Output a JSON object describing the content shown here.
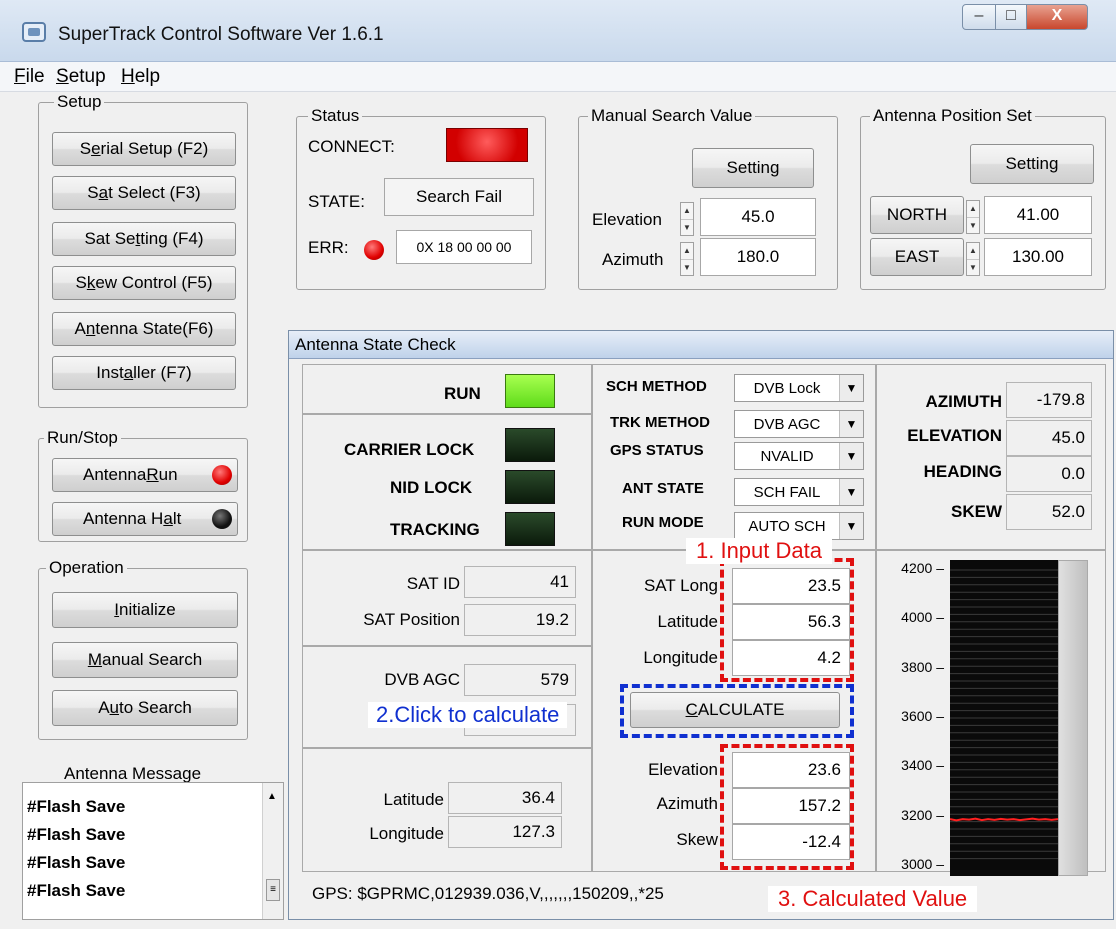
{
  "window": {
    "title": "SuperTrack Control Software Ver 1.6.1",
    "min_glyph": "–",
    "max_glyph": "□",
    "close_glyph": "X"
  },
  "menu": [
    {
      "accel": "F",
      "rest": "ile"
    },
    {
      "accel": "S",
      "rest": "etup"
    },
    {
      "accel": "H",
      "rest": "elp"
    }
  ],
  "setup": {
    "legend": "Setup",
    "serial": {
      "pre": "S",
      "accel": "e",
      "post": "rial Setup (F2)"
    },
    "sat_select": {
      "pre": "S",
      "accel": "a",
      "post": "t Select  (F3)"
    },
    "sat_setting": {
      "pre": "Sat Se",
      "accel": "t",
      "post": "ting  (F4)"
    },
    "skew": {
      "pre": "S",
      "accel": "k",
      "post": "ew Control (F5)"
    },
    "antenna_state": {
      "pre": "A",
      "accel": "n",
      "post": "tenna State(F6)"
    },
    "installer": {
      "pre": "Inst",
      "accel": "a",
      "post": "ller    (F7)"
    }
  },
  "runstop": {
    "legend": "Run/Stop",
    "run": {
      "pre": "Antenna ",
      "accel": "R",
      "post": "un"
    },
    "halt": {
      "pre": "Antenna H",
      "accel": "a",
      "post": "lt"
    }
  },
  "operation": {
    "legend": "Operation",
    "initialize": {
      "pre": "",
      "accel": "I",
      "post": "nitialize"
    },
    "manual": {
      "pre": "",
      "accel": "M",
      "post": "anual Search"
    },
    "auto": {
      "pre": "A",
      "accel": "u",
      "post": "to Search"
    }
  },
  "antenna_message": {
    "title": "Antenna Message",
    "lines": [
      "#Flash Save",
      "#Flash Save",
      "#Flash Save",
      "#Flash Save"
    ]
  },
  "status": {
    "legend": "Status",
    "connect_label": "CONNECT:",
    "state_label": "STATE:",
    "state_value": "Search Fail",
    "err_label": "ERR:",
    "err_value": "0X 18 00 00 00"
  },
  "manual_search": {
    "legend": "Manual Search Value",
    "setting": "Setting",
    "elevation_label": "Elevation",
    "elevation_value": "45.0",
    "azimuth_label": "Azimuth",
    "azimuth_value": "180.0"
  },
  "antenna_position": {
    "legend": "Antenna Position Set",
    "setting": "Setting",
    "north_label": "NORTH",
    "north_value": "41.00",
    "east_label": "EAST",
    "east_value": "130.00"
  },
  "asc": {
    "title": "Antenna State Check",
    "run_label": "RUN",
    "carrier_label": "CARRIER LOCK",
    "nid_label": "NID LOCK",
    "tracking_label": "TRACKING",
    "sch_method_label": "SCH METHOD",
    "sch_method_value": "DVB Lock",
    "trk_method_label": "TRK METHOD",
    "trk_method_value": "DVB AGC",
    "gps_status_label": "GPS STATUS",
    "gps_status_value": "NVALID",
    "ant_state_label": "ANT STATE",
    "ant_state_value": "SCH FAIL",
    "run_mode_label": "RUN MODE",
    "run_mode_value": "AUTO SCH",
    "azimuth_label": "AZIMUTH",
    "azimuth_value": "-179.8",
    "elevation_label": "ELEVATION",
    "elevation_value": "45.0",
    "heading_label": "HEADING",
    "heading_value": "0.0",
    "skew_label": "SKEW",
    "skew_value": "52.0",
    "sat_id_label": "SAT ID",
    "sat_id_value": "41",
    "sat_pos_label": "SAT Position",
    "sat_pos_value": "19.2",
    "dvb_agc_label": "DVB AGC",
    "dvb_agc_value": "579",
    "hidden_label_fragment": "D",
    "lat_label": "Latitude",
    "lat_value": "36.4",
    "lon_label": "Longitude",
    "lon_value": "127.3",
    "in_sat_long_label": "SAT Long",
    "in_sat_long_value": "23.5",
    "in_lat_label": "Latitude",
    "in_lat_value": "56.3",
    "in_lon_label": "Longitude",
    "in_lon_value": "4.2",
    "calculate": {
      "pre": "",
      "accel": "C",
      "post": "ALCULATE"
    },
    "out_elev_label": "Elevation",
    "out_elev_value": "23.6",
    "out_az_label": "Azimuth",
    "out_az_value": "157.2",
    "out_skew_label": "Skew",
    "out_skew_value": "-12.4",
    "gps_line": "GPS: $GPRMC,012939.036,V,,,,,,,150209,,*25"
  },
  "annotations": {
    "input": "1. Input Data",
    "click": "2.Click to calculate",
    "calculated": "3. Calculated Value"
  },
  "chart_data": {
    "type": "line",
    "ylim": [
      3000,
      4200
    ],
    "yticks": [
      4200,
      4000,
      3800,
      3600,
      3400,
      3200,
      3000
    ],
    "series": [
      {
        "values": [
          3190,
          3185,
          3190,
          3188,
          3192,
          3186,
          3190,
          3187,
          3191,
          3188,
          3190,
          3186,
          3189,
          3192,
          3188,
          3190,
          3187,
          3190
        ]
      }
    ]
  },
  "colors": {
    "annotation_red": "#e01010",
    "annotation_blue": "#1030d0",
    "led_connect": "#e00000",
    "led_run": "#7de52a",
    "chart_line": "#ff2020"
  }
}
